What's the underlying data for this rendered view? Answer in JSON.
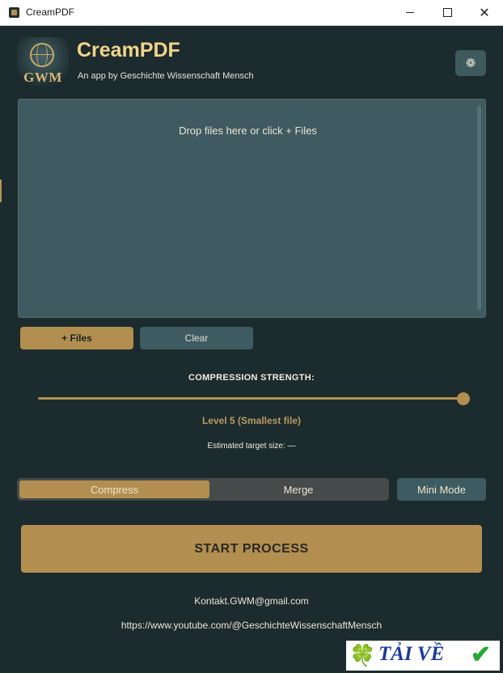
{
  "window": {
    "title": "CreamPDF",
    "minimize": "",
    "maximize": "",
    "close": "✕"
  },
  "header": {
    "logo_text": "GWM",
    "title": "CreamPDF",
    "subtitle": "An app by Geschichte Wissenschaft Mensch",
    "settings_icon": "❁"
  },
  "dropzone": {
    "hint": "Drop files here or click + Files"
  },
  "file_buttons": {
    "add": "+ Files",
    "clear": "Clear"
  },
  "compression": {
    "label": "COMPRESSION STRENGTH:",
    "level": 5,
    "level_max": 5,
    "level_text": "Level 5 (Smallest file)",
    "estimate": "Estimated target size: —"
  },
  "mode": {
    "options": [
      "Compress",
      "Merge"
    ],
    "selected": "Compress",
    "mini_mode": "Mini Mode"
  },
  "start_button": "START PROCESS",
  "footer": {
    "email": "Kontakt.GWM@gmail.com",
    "youtube": "https://www.youtube.com/@GeschichteWissenschaftMensch"
  },
  "watermark": {
    "text": "TẢI VỀ",
    "clover": "🍀",
    "check": "✔"
  },
  "colors": {
    "accent": "#b28f50",
    "background": "#1c2b2d",
    "panel": "#3f5b61",
    "title": "#f2d58b"
  }
}
